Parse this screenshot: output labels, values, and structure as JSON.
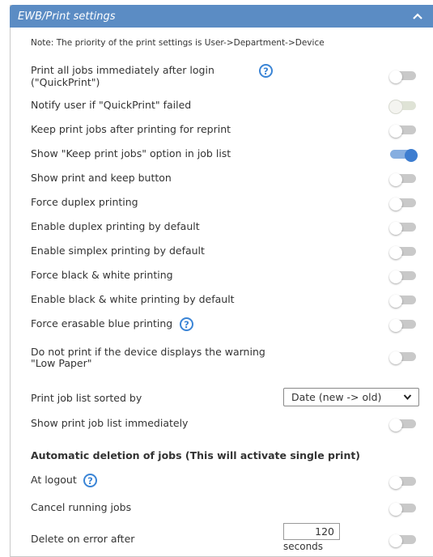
{
  "header": {
    "title": "EWB/Print settings"
  },
  "note": "Note: The priority of the print settings is User->Department->Device",
  "settings": [
    {
      "label": "Print all jobs immediately after login",
      "label2": "(\"QuickPrint\")",
      "state": "off",
      "help": true
    },
    {
      "label": "Notify user if \"QuickPrint\" failed",
      "state": "disabled"
    },
    {
      "label": "Keep print jobs after printing for reprint",
      "state": "off"
    },
    {
      "label": "Show \"Keep print jobs\" option in job list",
      "state": "on"
    },
    {
      "label": "Show print and keep button",
      "state": "off"
    },
    {
      "label": "Force duplex printing",
      "state": "off"
    },
    {
      "label": "Enable duplex printing by default",
      "state": "off"
    },
    {
      "label": "Enable simplex printing by default",
      "state": "off"
    },
    {
      "label": "Force black & white printing",
      "state": "off"
    },
    {
      "label": "Enable black & white printing by default",
      "state": "off"
    },
    {
      "label": "Force erasable blue printing",
      "state": "off",
      "help": true
    },
    {
      "label": "Do not print if the device displays the warning",
      "label2": "\"Low Paper\"",
      "state": "off"
    }
  ],
  "sort": {
    "label": "Print job list sorted by",
    "value": "Date (new -> old)"
  },
  "show_list": {
    "label": "Show print job list immediately",
    "state": "off"
  },
  "auto_delete": {
    "title": "Automatic deletion of jobs (This will activate single print)",
    "at_logout": "At logout",
    "cancel_running": "Cancel running jobs",
    "delete_on_error": "Delete on error after",
    "delete_value": "120",
    "delete_unit": "seconds"
  },
  "help_glyph": "?",
  "colors": {
    "header_bg": "#5b8cc4",
    "toggle_on": "#3d7dd0",
    "help": "#3b85d6"
  }
}
